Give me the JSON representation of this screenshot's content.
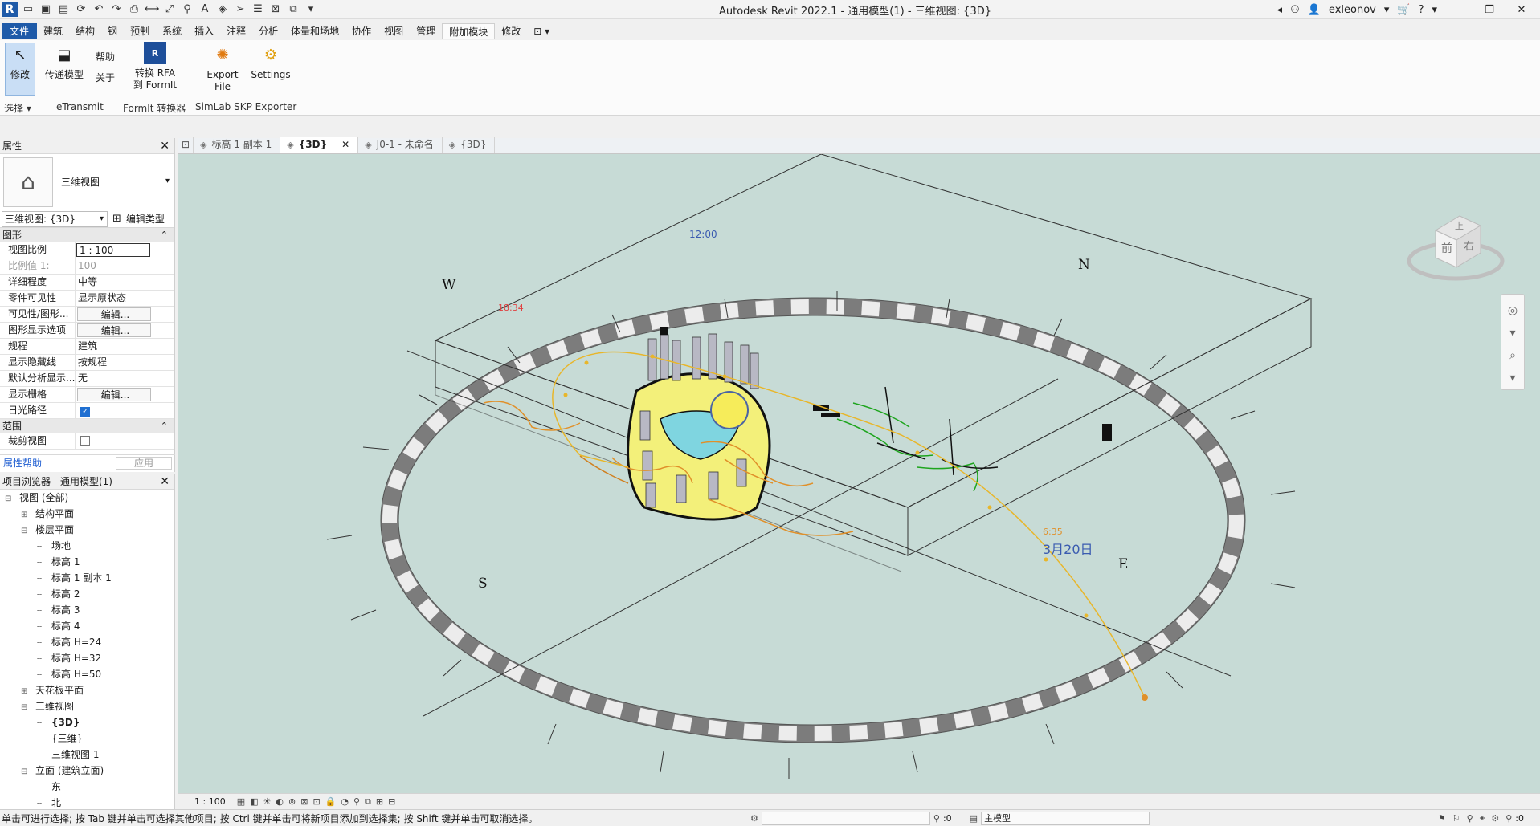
{
  "app": {
    "title": "Autodesk Revit 2022.1 - 通用模型(1) - 三维视图: {3D}",
    "user": "exleonov",
    "help_icon": "?"
  },
  "menu": {
    "tabs": [
      "文件",
      "建筑",
      "结构",
      "钢",
      "预制",
      "系统",
      "插入",
      "注释",
      "分析",
      "体量和场地",
      "协作",
      "视图",
      "管理",
      "附加模块",
      "修改"
    ],
    "active": "附加模块"
  },
  "ribbon": {
    "modify": "修改",
    "select_panel": "选择",
    "transmit": "传递模型",
    "help": "帮助",
    "about": "关于",
    "etransmit_panel": "eTransmit",
    "convert_rfa": "转换 RFA",
    "to_formit": "到 FormIt",
    "formit_panel": "FormIt 转换器",
    "export_file": "Export File",
    "settings": "Settings",
    "simlab_panel": "SimLab SKP Exporter"
  },
  "properties": {
    "header": "属性",
    "type_name": "三维视图",
    "view_selector": "三维视图: {3D}",
    "edit_type": "编辑类型",
    "section_graphics": "图形",
    "section_extents": "范围",
    "rows": [
      {
        "key": "视图比例",
        "value": "1 : 100",
        "kind": "boxed"
      },
      {
        "key": "比例值 1:",
        "value": "100",
        "kind": "dim"
      },
      {
        "key": "详细程度",
        "value": "中等",
        "kind": "text"
      },
      {
        "key": "零件可见性",
        "value": "显示原状态",
        "kind": "text"
      },
      {
        "key": "可见性/图形...",
        "value": "编辑...",
        "kind": "btn"
      },
      {
        "key": "图形显示选项",
        "value": "编辑...",
        "kind": "btn"
      },
      {
        "key": "规程",
        "value": "建筑",
        "kind": "text"
      },
      {
        "key": "显示隐藏线",
        "value": "按规程",
        "kind": "text"
      },
      {
        "key": "默认分析显示...",
        "value": "无",
        "kind": "text"
      },
      {
        "key": "显示栅格",
        "value": "编辑...",
        "kind": "btn"
      },
      {
        "key": "日光路径",
        "value": "",
        "kind": "check-on"
      }
    ],
    "extent_row": {
      "key": "裁剪视图",
      "value": ""
    },
    "help_link": "属性帮助",
    "apply": "应用"
  },
  "browser": {
    "header": "项目浏览器 - 通用模型(1)",
    "nodes": [
      {
        "label": "视图 (全部)",
        "level": 0,
        "toggle": "⊟"
      },
      {
        "label": "结构平面",
        "level": 1,
        "toggle": "⊞"
      },
      {
        "label": "楼层平面",
        "level": 1,
        "toggle": "⊟"
      },
      {
        "label": "场地",
        "level": 2,
        "toggle": ""
      },
      {
        "label": "标高 1",
        "level": 2,
        "toggle": ""
      },
      {
        "label": "标高 1 副本 1",
        "level": 2,
        "toggle": ""
      },
      {
        "label": "标高 2",
        "level": 2,
        "toggle": ""
      },
      {
        "label": "标高 3",
        "level": 2,
        "toggle": ""
      },
      {
        "label": "标高 4",
        "level": 2,
        "toggle": ""
      },
      {
        "label": "标高 H=24",
        "level": 2,
        "toggle": ""
      },
      {
        "label": "标高 H=32",
        "level": 2,
        "toggle": ""
      },
      {
        "label": "标高 H=50",
        "level": 2,
        "toggle": ""
      },
      {
        "label": "天花板平面",
        "level": 1,
        "toggle": "⊞"
      },
      {
        "label": "三维视图",
        "level": 1,
        "toggle": "⊟"
      },
      {
        "label": "{3D}",
        "level": 2,
        "toggle": "",
        "bold": true
      },
      {
        "label": "{三维}",
        "level": 2,
        "toggle": ""
      },
      {
        "label": "三维视图 1",
        "level": 2,
        "toggle": ""
      },
      {
        "label": "立面 (建筑立面)",
        "level": 1,
        "toggle": "⊟"
      },
      {
        "label": "东",
        "level": 2,
        "toggle": ""
      },
      {
        "label": "北",
        "level": 2,
        "toggle": ""
      }
    ]
  },
  "viewtabs": [
    {
      "label": "标高 1 副本 1",
      "active": false
    },
    {
      "label": "{3D}",
      "active": true
    },
    {
      "label": "J0-1 - 未命名",
      "active": false
    },
    {
      "label": "{3D}",
      "active": false
    }
  ],
  "scene": {
    "compass": {
      "n": "N",
      "e": "E",
      "s": "S",
      "w": "W"
    },
    "sun_time_noon": "12:00",
    "sun_time_rise": "6:35",
    "sun_time_set": "18:34",
    "date": "3月20日",
    "viewcube": {
      "front": "前",
      "right": "右",
      "top": "上"
    },
    "colors": {
      "background": "#c7dbd6",
      "sun": "#f6ec5a",
      "path": "#e8b62a"
    }
  },
  "viewctrl": {
    "scale": "1 : 100"
  },
  "status": {
    "message": "单击可进行选择; 按 Tab 键并单击可选择其他项目; 按 Ctrl 键并单击可将新项目添加到选择集; 按 Shift 键并单击可取消选择。",
    "coord": ":0",
    "model": "主模型",
    "filter": ":0"
  }
}
